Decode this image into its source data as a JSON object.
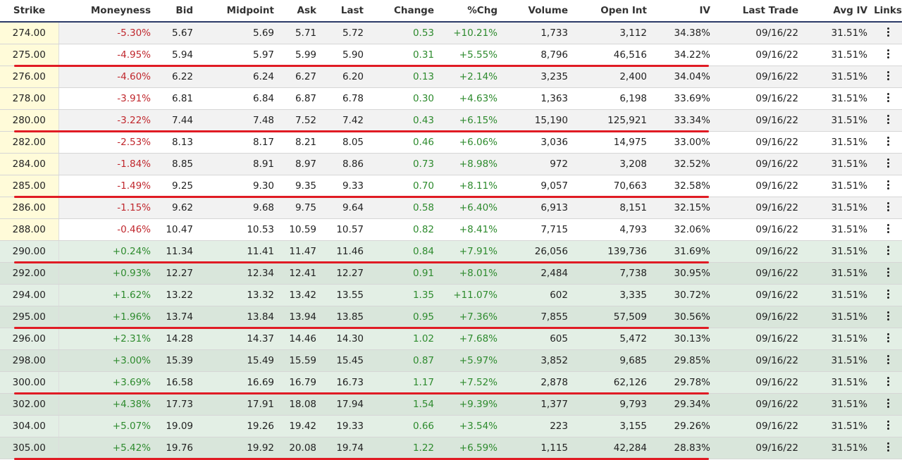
{
  "headers": {
    "strike": "Strike",
    "moneyness": "Moneyness",
    "bid": "Bid",
    "midpoint": "Midpoint",
    "ask": "Ask",
    "last": "Last",
    "change": "Change",
    "pctchg": "%Chg",
    "volume": "Volume",
    "open_int": "Open Int",
    "iv": "IV",
    "last_trade": "Last Trade",
    "avg_iv": "Avg IV",
    "links": "Links"
  },
  "colors": {
    "negative": "#c0272d",
    "positive": "#2e8b2e",
    "highlight_line": "#e01b24",
    "header_border": "#2b3a67"
  },
  "rows": [
    [
      "274.00",
      "-5.30%",
      "5.67",
      "5.69",
      "5.71",
      "5.72",
      "0.53",
      "+10.21%",
      "1,733",
      "3,112",
      "34.38%",
      "09/16/22",
      "31.51%"
    ],
    [
      "275.00",
      "-4.95%",
      "5.94",
      "5.97",
      "5.99",
      "5.90",
      "0.31",
      "+5.55%",
      "8,796",
      "46,516",
      "34.22%",
      "09/16/22",
      "31.51%"
    ],
    [
      "276.00",
      "-4.60%",
      "6.22",
      "6.24",
      "6.27",
      "6.20",
      "0.13",
      "+2.14%",
      "3,235",
      "2,400",
      "34.04%",
      "09/16/22",
      "31.51%"
    ],
    [
      "278.00",
      "-3.91%",
      "6.81",
      "6.84",
      "6.87",
      "6.78",
      "0.30",
      "+4.63%",
      "1,363",
      "6,198",
      "33.69%",
      "09/16/22",
      "31.51%"
    ],
    [
      "280.00",
      "-3.22%",
      "7.44",
      "7.48",
      "7.52",
      "7.42",
      "0.43",
      "+6.15%",
      "15,190",
      "125,921",
      "33.34%",
      "09/16/22",
      "31.51%"
    ],
    [
      "282.00",
      "-2.53%",
      "8.13",
      "8.17",
      "8.21",
      "8.05",
      "0.46",
      "+6.06%",
      "3,036",
      "14,975",
      "33.00%",
      "09/16/22",
      "31.51%"
    ],
    [
      "284.00",
      "-1.84%",
      "8.85",
      "8.91",
      "8.97",
      "8.86",
      "0.73",
      "+8.98%",
      "972",
      "3,208",
      "32.52%",
      "09/16/22",
      "31.51%"
    ],
    [
      "285.00",
      "-1.49%",
      "9.25",
      "9.30",
      "9.35",
      "9.33",
      "0.70",
      "+8.11%",
      "9,057",
      "70,663",
      "32.58%",
      "09/16/22",
      "31.51%"
    ],
    [
      "286.00",
      "-1.15%",
      "9.62",
      "9.68",
      "9.75",
      "9.64",
      "0.58",
      "+6.40%",
      "6,913",
      "8,151",
      "32.15%",
      "09/16/22",
      "31.51%"
    ],
    [
      "288.00",
      "-0.46%",
      "10.47",
      "10.53",
      "10.59",
      "10.57",
      "0.82",
      "+8.41%",
      "7,715",
      "4,793",
      "32.06%",
      "09/16/22",
      "31.51%"
    ],
    [
      "290.00",
      "+0.24%",
      "11.34",
      "11.41",
      "11.47",
      "11.46",
      "0.84",
      "+7.91%",
      "26,056",
      "139,736",
      "31.69%",
      "09/16/22",
      "31.51%"
    ],
    [
      "292.00",
      "+0.93%",
      "12.27",
      "12.34",
      "12.41",
      "12.27",
      "0.91",
      "+8.01%",
      "2,484",
      "7,738",
      "30.95%",
      "09/16/22",
      "31.51%"
    ],
    [
      "294.00",
      "+1.62%",
      "13.22",
      "13.32",
      "13.42",
      "13.55",
      "1.35",
      "+11.07%",
      "602",
      "3,335",
      "30.72%",
      "09/16/22",
      "31.51%"
    ],
    [
      "295.00",
      "+1.96%",
      "13.74",
      "13.84",
      "13.94",
      "13.85",
      "0.95",
      "+7.36%",
      "7,855",
      "57,509",
      "30.56%",
      "09/16/22",
      "31.51%"
    ],
    [
      "296.00",
      "+2.31%",
      "14.28",
      "14.37",
      "14.46",
      "14.30",
      "1.02",
      "+7.68%",
      "605",
      "5,472",
      "30.13%",
      "09/16/22",
      "31.51%"
    ],
    [
      "298.00",
      "+3.00%",
      "15.39",
      "15.49",
      "15.59",
      "15.45",
      "0.87",
      "+5.97%",
      "3,852",
      "9,685",
      "29.85%",
      "09/16/22",
      "31.51%"
    ],
    [
      "300.00",
      "+3.69%",
      "16.58",
      "16.69",
      "16.79",
      "16.73",
      "1.17",
      "+7.52%",
      "2,878",
      "62,126",
      "29.78%",
      "09/16/22",
      "31.51%"
    ],
    [
      "302.00",
      "+4.38%",
      "17.73",
      "17.91",
      "18.08",
      "17.94",
      "1.54",
      "+9.39%",
      "1,377",
      "9,793",
      "29.34%",
      "09/16/22",
      "31.51%"
    ],
    [
      "304.00",
      "+5.07%",
      "19.09",
      "19.26",
      "19.42",
      "19.33",
      "0.66",
      "+3.54%",
      "223",
      "3,155",
      "29.26%",
      "09/16/22",
      "31.51%"
    ],
    [
      "305.00",
      "+5.42%",
      "19.76",
      "19.92",
      "20.08",
      "19.74",
      "1.22",
      "+6.59%",
      "1,115",
      "42,284",
      "28.83%",
      "09/16/22",
      "31.51%"
    ]
  ],
  "underlined_strikes": [
    "275.00",
    "280.00",
    "285.00",
    "290.00",
    "295.00",
    "300.00",
    "305.00"
  ]
}
